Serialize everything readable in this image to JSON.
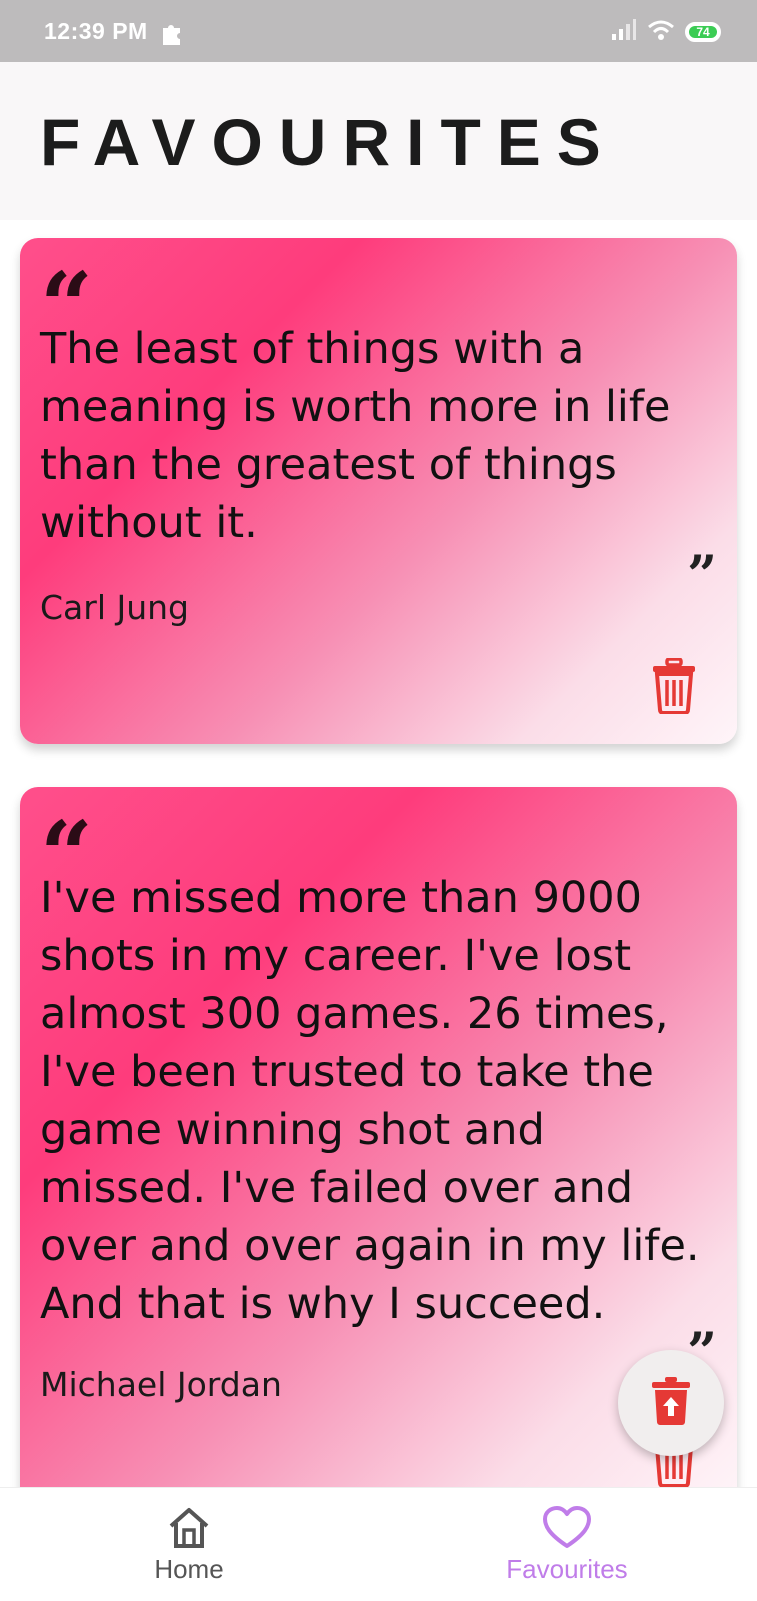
{
  "status_bar": {
    "time": "12:39 PM",
    "battery": "74"
  },
  "header": {
    "title": "FAVOURITES"
  },
  "quotes": [
    {
      "open_mark": "“",
      "text": "The least of things with a meaning is worth more in life than the greatest of things without it.",
      "close_mark": "”",
      "author": "Carl Jung"
    },
    {
      "open_mark": "“",
      "text": "I've missed more than 9000 shots in my career. I've lost almost 300 games. 26 times, I've been trusted to take the game winning shot and missed. I've failed over and over and over again in my life. And that is why I succeed.",
      "close_mark": "”",
      "author": "Michael Jordan"
    }
  ],
  "bottom_nav": {
    "home_label": "Home",
    "favourites_label": "Favourites"
  },
  "colors": {
    "accent": "#c07de9",
    "delete": "#e53935",
    "card_gradient_start": "#fe3c7c"
  },
  "icons": {
    "delete": "trash-icon",
    "scroll_top": "arrow-up-icon",
    "home": "home-icon",
    "favourites": "heart-icon"
  }
}
